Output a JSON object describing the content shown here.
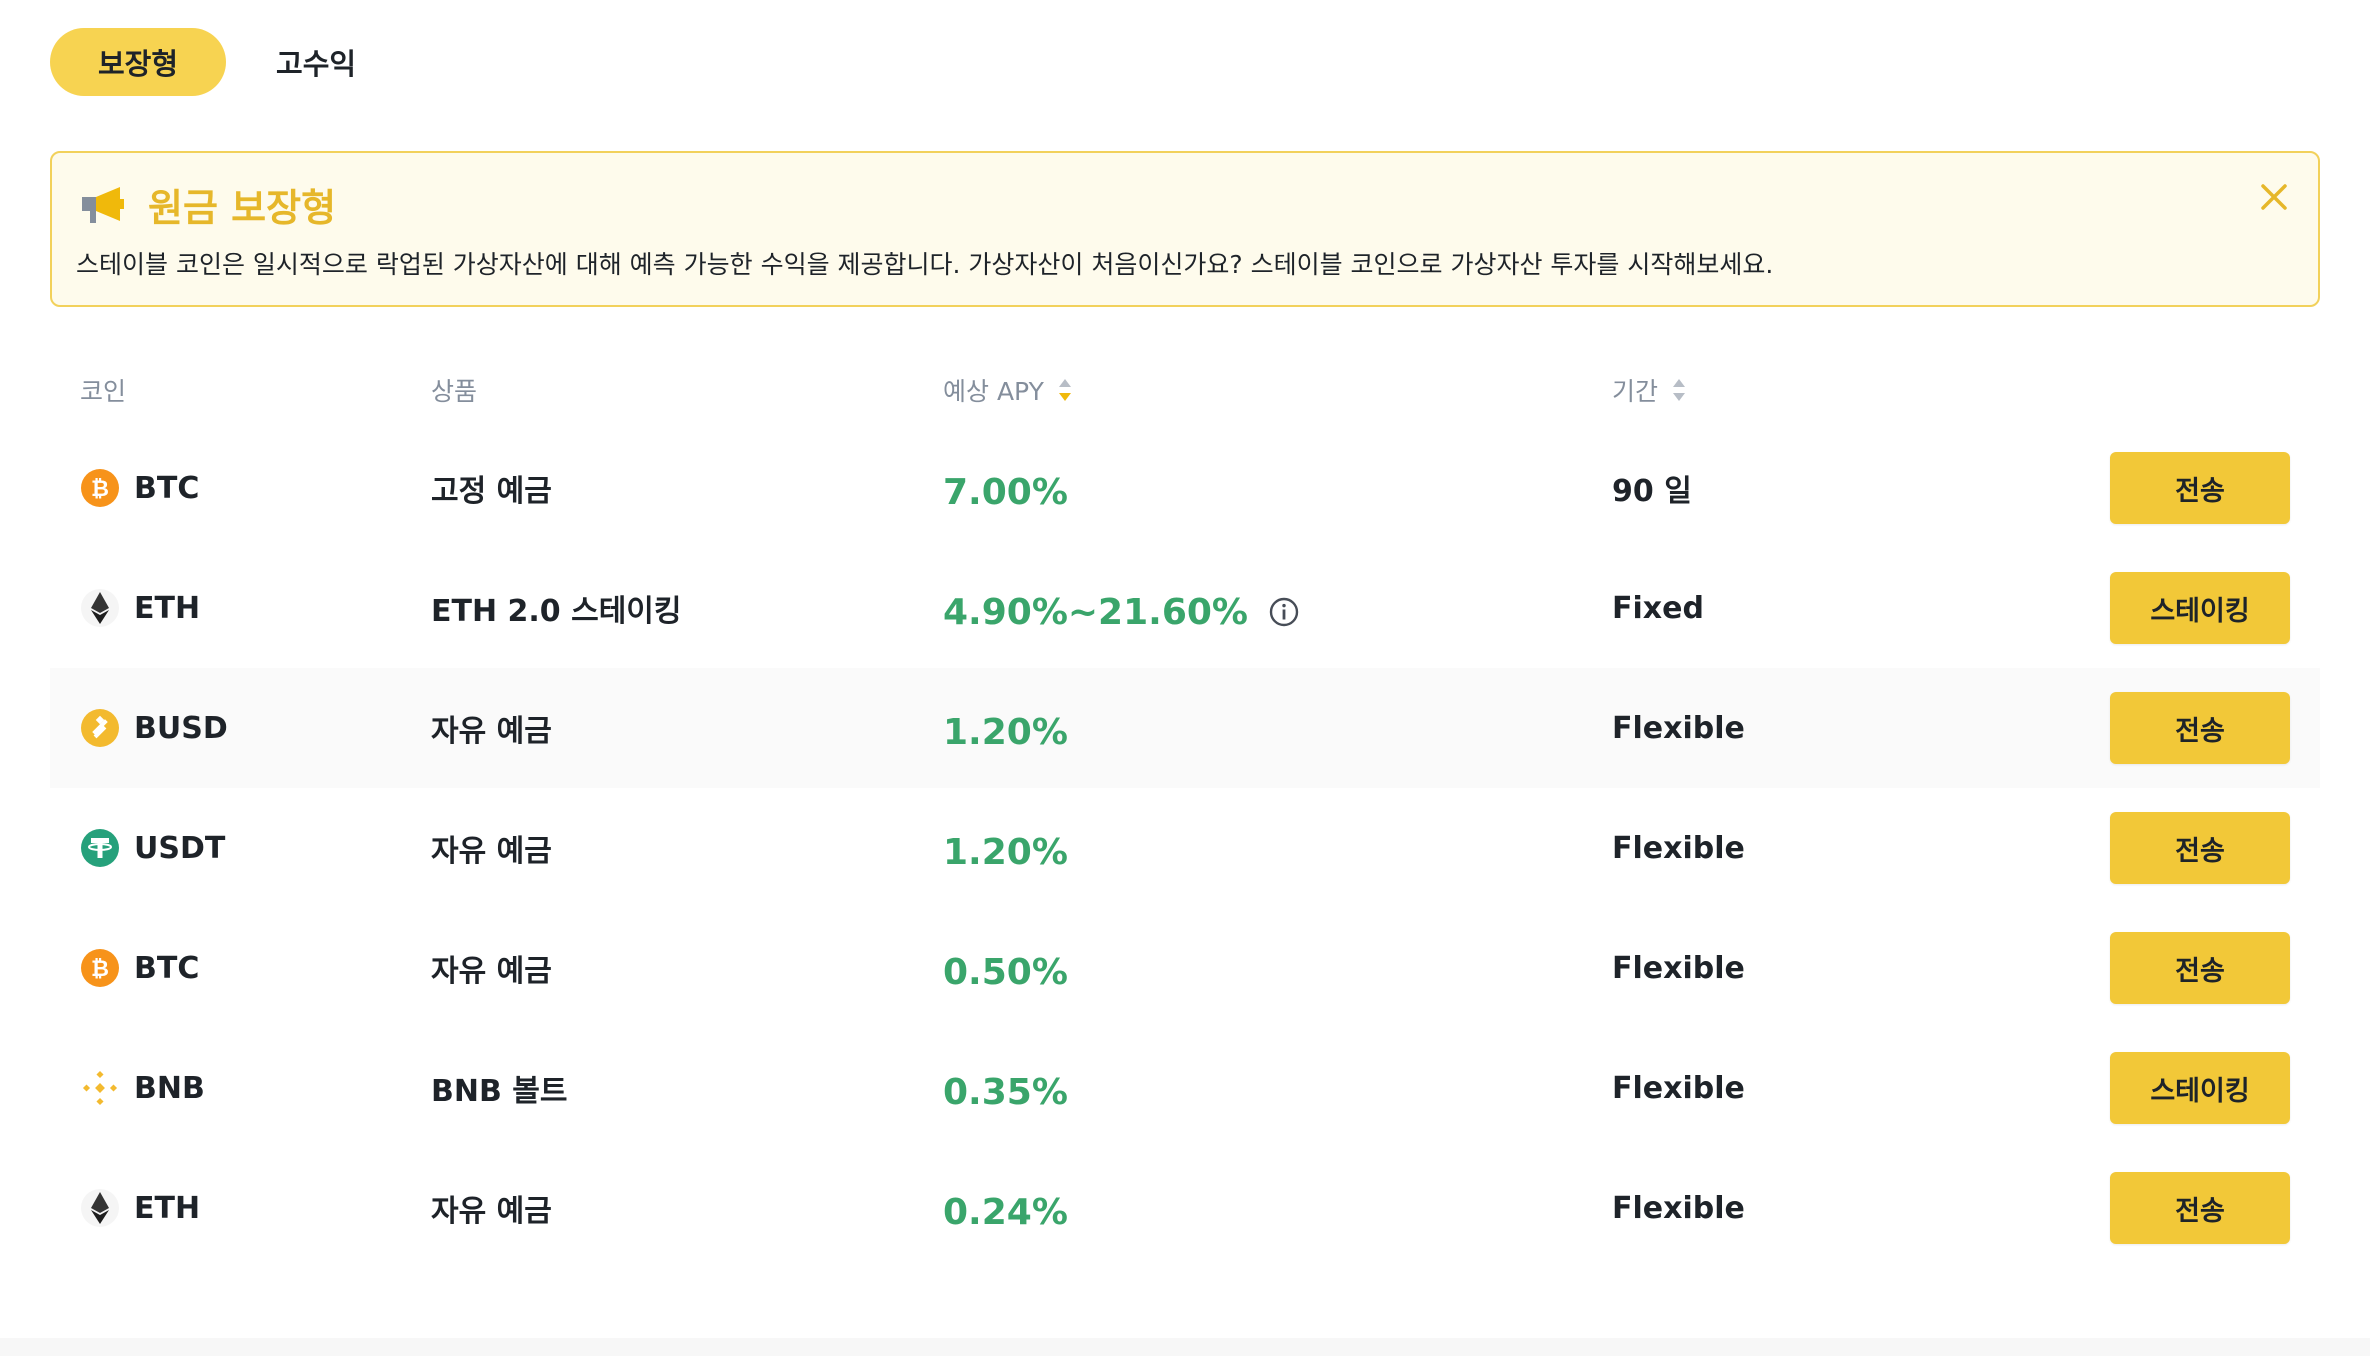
{
  "tabs": [
    {
      "label": "보장형",
      "active": true
    },
    {
      "label": "고수익",
      "active": false
    }
  ],
  "banner": {
    "title": "원금 보장형",
    "description": "스테이블 코인은 일시적으로 락업된 가상자산에 대해 예측 가능한 수익을 제공합니다. 가상자산이 처음이신가요? 스테이블 코인으로 가상자산 투자를 시작해보세요.",
    "accent_color": "#f0b90b",
    "icon": "megaphone-icon",
    "close_icon": "close-icon"
  },
  "table": {
    "headers": {
      "coin": "코인",
      "product": "상품",
      "apy": "예상 APY",
      "term": "기간"
    },
    "rows": [
      {
        "coin": "BTC",
        "icon": "btc-icon",
        "product": "고정 예금",
        "apy": "7.00%",
        "term": "90 일",
        "action": "전송",
        "info": false,
        "highlight": false
      },
      {
        "coin": "ETH",
        "icon": "eth-icon",
        "product": "ETH 2.0 스테이킹",
        "apy": "4.90%~21.60%",
        "term": "Fixed",
        "action": "스테이킹",
        "info": true,
        "highlight": false
      },
      {
        "coin": "BUSD",
        "icon": "busd-icon",
        "product": "자유 예금",
        "apy": "1.20%",
        "term": "Flexible",
        "action": "전송",
        "info": false,
        "highlight": true
      },
      {
        "coin": "USDT",
        "icon": "usdt-icon",
        "product": "자유 예금",
        "apy": "1.20%",
        "term": "Flexible",
        "action": "전송",
        "info": false,
        "highlight": false
      },
      {
        "coin": "BTC",
        "icon": "btc-icon",
        "product": "자유 예금",
        "apy": "0.50%",
        "term": "Flexible",
        "action": "전송",
        "info": false,
        "highlight": false
      },
      {
        "coin": "BNB",
        "icon": "bnb-icon",
        "product": "BNB 볼트",
        "apy": "0.35%",
        "term": "Flexible",
        "action": "스테이킹",
        "info": false,
        "highlight": false
      },
      {
        "coin": "ETH",
        "icon": "eth-icon",
        "product": "자유 예금",
        "apy": "0.24%",
        "term": "Flexible",
        "action": "전송",
        "info": false,
        "highlight": false
      }
    ]
  },
  "colors": {
    "apy_green": "#3aa56b",
    "button_yellow": "#f2c838",
    "btc_orange": "#f7931a",
    "usdt_green": "#26a17b",
    "bnb_yellow": "#f3ba2f"
  }
}
